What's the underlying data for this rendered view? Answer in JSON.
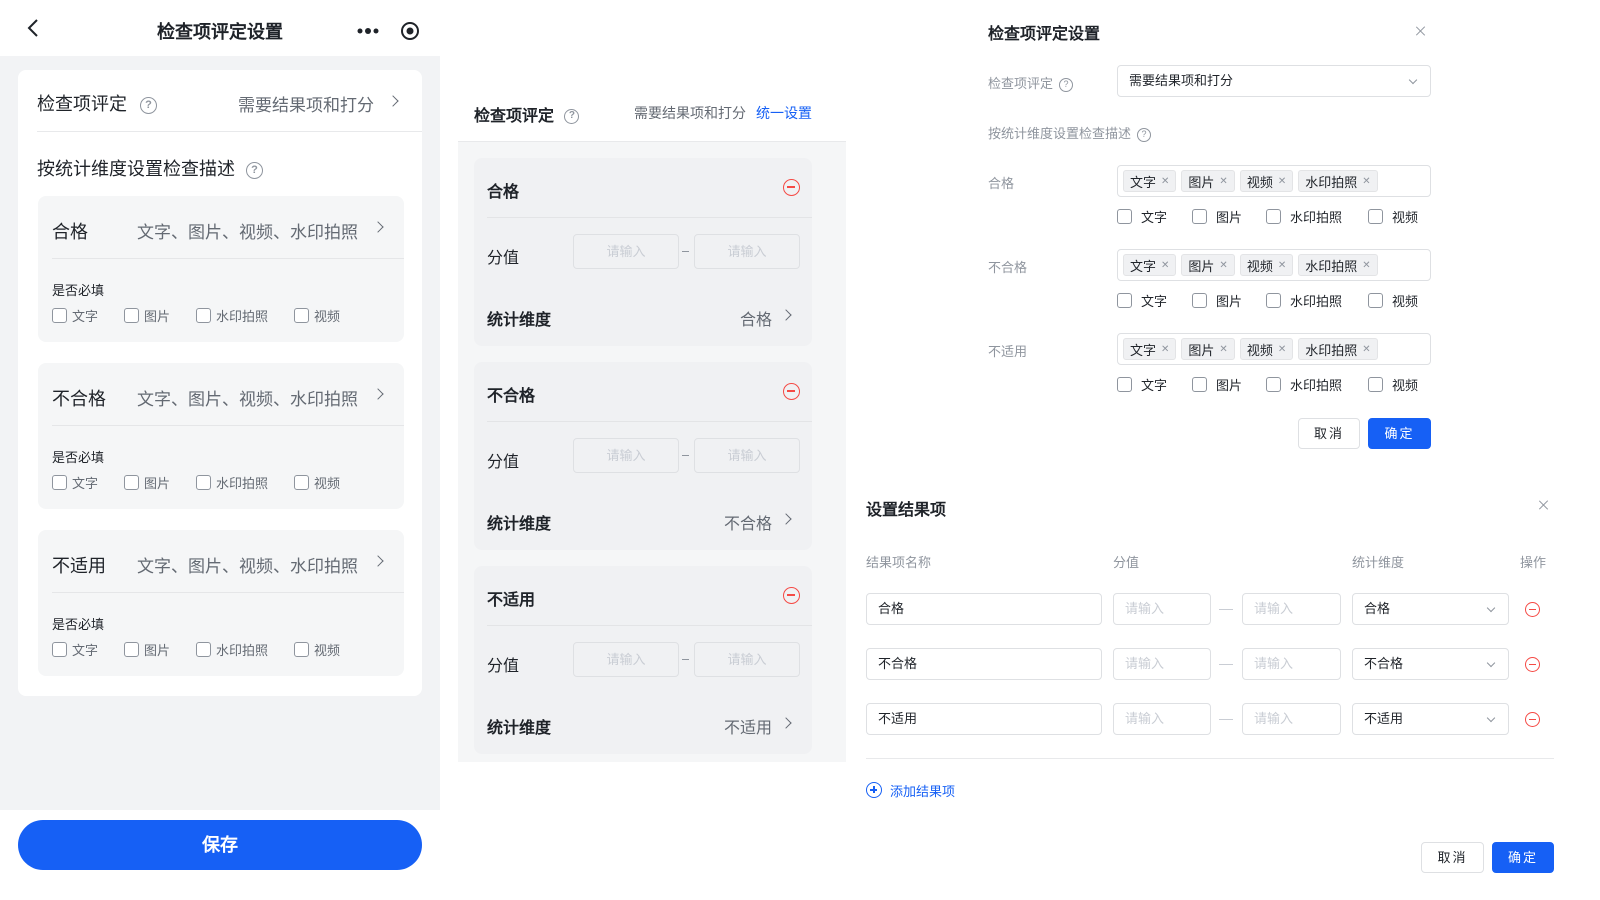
{
  "mobile": {
    "title": "检查项评定设置",
    "more_icon": "more-dots-icon",
    "target_icon": "target-icon",
    "eval_label": "检查项评定",
    "eval_value": "需要结果项和打分",
    "desc_label": "按统计维度设置检查描述",
    "required_label": "是否必填",
    "groups": [
      {
        "name": "合格",
        "value": "文字、图片、视频、水印拍照"
      },
      {
        "name": "不合格",
        "value": "文字、图片、视频、水印拍照"
      },
      {
        "name": "不适用",
        "value": "文字、图片、视频、水印拍照"
      }
    ],
    "checkbox_options": [
      "文字",
      "图片",
      "水印拍照",
      "视频"
    ],
    "save_label": "保存"
  },
  "panel2": {
    "eval_label": "检查项评定",
    "eval_value": "需要结果项和打分",
    "unify_link": "统一设置",
    "score_label": "分值",
    "dim_label": "统计维度",
    "placeholder": "请输入",
    "results": [
      {
        "name": "合格",
        "dim": "合格"
      },
      {
        "name": "不合格",
        "dim": "不合格"
      },
      {
        "name": "不适用",
        "dim": "不适用"
      }
    ]
  },
  "dialog1": {
    "title": "检查项评定设置",
    "eval_label": "检查项评定",
    "eval_value": "需要结果项和打分",
    "desc_label": "按统计维度设置检查描述",
    "rows": [
      {
        "label": "合格",
        "tags": [
          "文字",
          "图片",
          "视频",
          "水印拍照"
        ]
      },
      {
        "label": "不合格",
        "tags": [
          "文字",
          "图片",
          "视频",
          "水印拍照"
        ]
      },
      {
        "label": "不适用",
        "tags": [
          "文字",
          "图片",
          "视频",
          "水印拍照"
        ]
      }
    ],
    "checkbox_options": [
      "文字",
      "图片",
      "水印拍照",
      "视频"
    ],
    "cancel_label": "取消",
    "ok_label": "确定"
  },
  "dialog2": {
    "title": "设置结果项",
    "columns": [
      "结果项名称",
      "分值",
      "统计维度",
      "操作"
    ],
    "placeholder": "请输入",
    "rows": [
      {
        "name": "合格",
        "dim": "合格"
      },
      {
        "name": "不合格",
        "dim": "不合格"
      },
      {
        "name": "不适用",
        "dim": "不适用"
      }
    ],
    "add_label": "添加结果项",
    "cancel_label": "取消",
    "ok_label": "确定"
  },
  "colors": {
    "primary": "#1660f5",
    "danger": "#f54a45",
    "muted": "#8f959e"
  }
}
